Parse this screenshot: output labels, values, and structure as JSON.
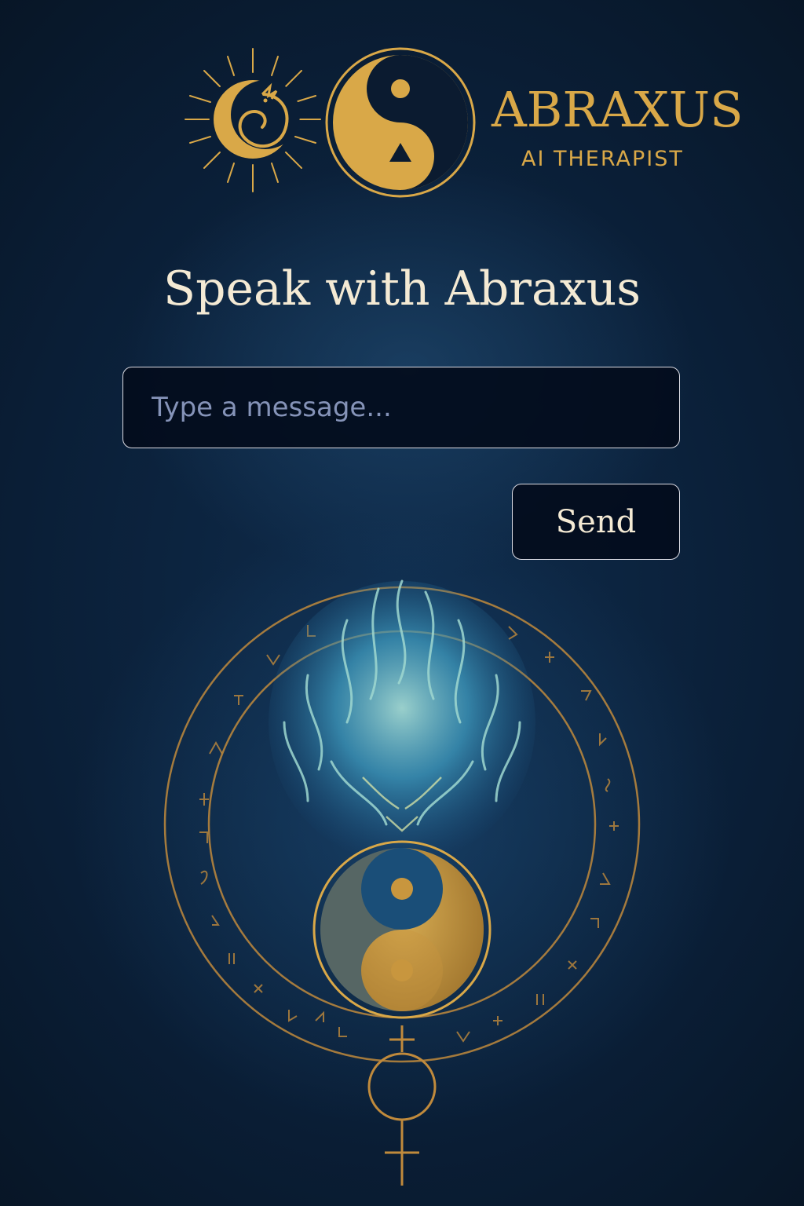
{
  "brand": {
    "name": "ABRAXUS",
    "tagline": "AI THERAPIST",
    "icons": [
      "sun-dragon-emblem",
      "yin-yang-logo"
    ]
  },
  "chat": {
    "title": "Speak with Abraxus",
    "input_placeholder": "Type a message...",
    "input_value": "",
    "send_label": "Send"
  },
  "illustration": {
    "icons": [
      "abraxus-face-icon",
      "yin-yang-icon",
      "rune-circle",
      "planet-cross-symbol"
    ]
  },
  "colors": {
    "background": "#0a1e36",
    "gold": "#d9a848",
    "cream_text": "#f4ead4",
    "placeholder": "#8593b8",
    "border": "#dcdce4",
    "spirit_blue": "#4aa8c8"
  }
}
